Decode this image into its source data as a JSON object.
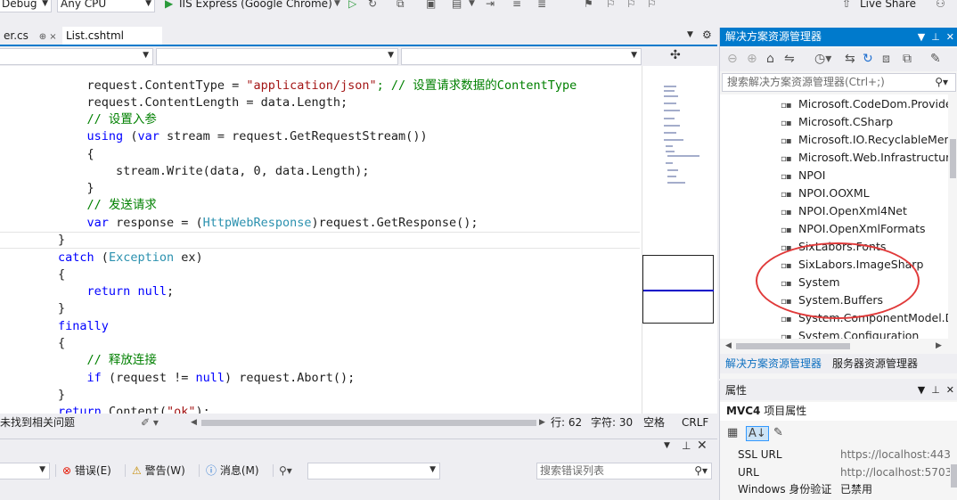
{
  "toolbar": {
    "config": "Debug",
    "platform": "Any CPU",
    "run_target": "IIS Express (Google Chrome)",
    "live_share": "Live Share"
  },
  "tabs": [
    {
      "label": "er.cs",
      "close": "⊕ ×"
    },
    {
      "label": "List.cshtml"
    }
  ],
  "code": {
    "line1": {
      "a": "        request.ContentType = ",
      "b": "\"application/json\"",
      "c": "; // 设置请求数据的ContentType"
    },
    "line2": "        request.ContentLength = data.Length;",
    "line3": "        // 设置入参",
    "line4": {
      "kw1": "using",
      "p1": " (",
      "kw2": "var",
      "p2": " stream = request.GetRequestStream())"
    },
    "line5": "        {",
    "line6": "            stream.Write(data, 0, data.Length);",
    "line7": "        }",
    "line8": "        // 发送请求",
    "line9": {
      "kw": "var",
      "p1": " response = (",
      "ty": "HttpWebResponse",
      "p2": ")request.GetResponse();"
    },
    "line10": "    }",
    "line11": {
      "kw": "catch",
      "p1": " (",
      "ty": "Exception",
      "p2": " ex)"
    },
    "line12": "    {",
    "line13": {
      "kw": "return",
      "kw2": "null",
      "p": ";"
    },
    "line14": "    }",
    "line15": "finally",
    "line16": "    {",
    "line17": "        // 释放连接",
    "line18": {
      "kw": "if",
      "p1": " (request != ",
      "kw2": "null",
      "p2": ") request.Abort();"
    },
    "line19": "    }",
    "line20": {
      "kw": "return",
      "p1": " Content(",
      "st": "\"ok\"",
      "p2": ");"
    }
  },
  "editor_status": {
    "issues": "未找到相关问题",
    "line": "行: 62",
    "char": "字符: 30",
    "whitespace": "空格",
    "eol": "CRLF"
  },
  "error_list": {
    "errors": "错误(E)",
    "warnings": "警告(W)",
    "messages": "消息(M)",
    "search_placeholder": "搜索错误列表"
  },
  "solution_explorer": {
    "title": "解决方案资源管理器",
    "search_placeholder": "搜索解决方案资源管理器(Ctrl+;)",
    "items": [
      "Microsoft.CodeDom.Providers",
      "Microsoft.CSharp",
      "Microsoft.IO.RecyclableMemory",
      "Microsoft.Web.Infrastructure",
      "NPOI",
      "NPOI.OOXML",
      "NPOI.OpenXml4Net",
      "NPOI.OpenXmlFormats",
      "SixLabors.Fonts",
      "SixLabors.ImageSharp",
      "System",
      "System.Buffers",
      "System.ComponentModel.D",
      "System.Configuration"
    ],
    "tab_solution": "解决方案资源管理器",
    "tab_server": "服务器资源管理器",
    "annotation_color": "#e03a3a"
  },
  "properties": {
    "title": "属性",
    "object_name": "MVC4",
    "object_type": "项目属性",
    "rows": [
      {
        "key": "SSL URL",
        "value": "https://localhost:443"
      },
      {
        "key": "URL",
        "value": "http://localhost:5703"
      },
      {
        "key": "Windows 身份验证",
        "value": "已禁用"
      }
    ]
  },
  "colors": {
    "accent": "#007acc",
    "keyword": "#0000ff",
    "type": "#2b91af",
    "comment": "#008000",
    "string": "#a31515"
  }
}
